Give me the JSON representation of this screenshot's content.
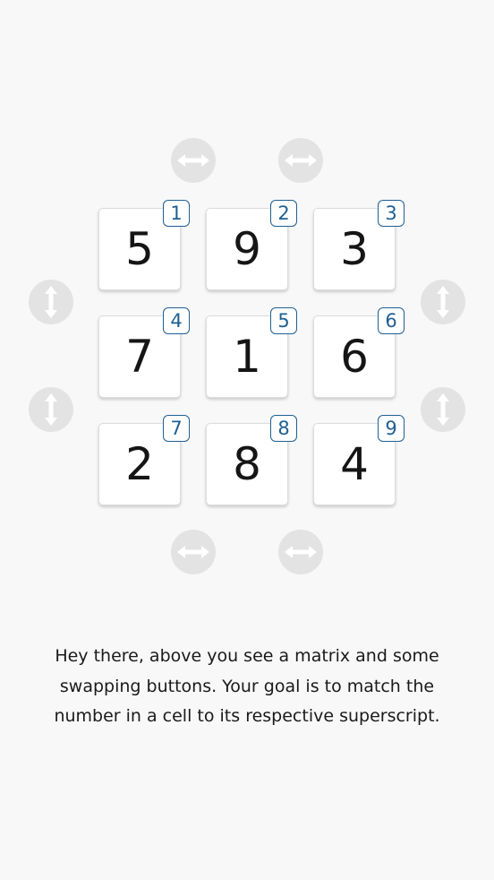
{
  "board": {
    "cells": [
      {
        "value": "5",
        "sup": "1"
      },
      {
        "value": "9",
        "sup": "2"
      },
      {
        "value": "3",
        "sup": "3"
      },
      {
        "value": "7",
        "sup": "4"
      },
      {
        "value": "1",
        "sup": "5"
      },
      {
        "value": "6",
        "sup": "6"
      },
      {
        "value": "2",
        "sup": "7"
      },
      {
        "value": "8",
        "sup": "8"
      },
      {
        "value": "4",
        "sup": "9"
      }
    ]
  },
  "buttons": {
    "icon_color": "#ffffff",
    "bg_color": "#e3e3e3",
    "horizontal_icon": "double-arrow-horizontal-icon",
    "vertical_icon": "double-arrow-vertical-icon"
  },
  "instructions": {
    "text": "Hey there, above you see a matrix and some swapping buttons. Your goal is to match the number in a cell to its respective superscript."
  }
}
